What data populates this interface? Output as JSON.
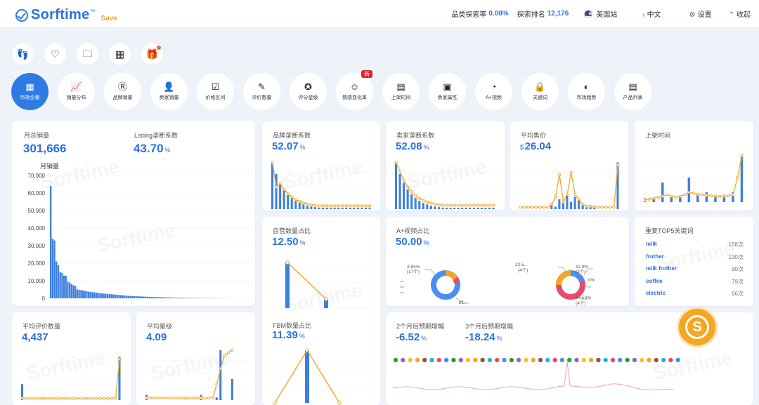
{
  "header": {
    "brand": "Sorftime",
    "trademark": "™",
    "save_label": "Save",
    "cat_label": "品类探索率",
    "cat_value": "0.00%",
    "rank_label": "探索排名",
    "rank_value": "12,176",
    "site_label": "美国站",
    "lang_label": "中文",
    "settings_label": "设置",
    "collapse_label": "收起"
  },
  "quick_icons": [
    "footprint-icon",
    "heart-icon",
    "folder-icon",
    "grid-icon",
    "gift-icon"
  ],
  "tabs": [
    {
      "label": "市场全景",
      "icon": "▦",
      "active": true
    },
    {
      "label": "销量分布",
      "icon": "📈"
    },
    {
      "label": "品牌销量",
      "icon": "Ⓡ"
    },
    {
      "label": "卖家销量",
      "icon": "👤"
    },
    {
      "label": "价格区间",
      "icon": "☑"
    },
    {
      "label": "评价数量",
      "icon": "✎"
    },
    {
      "label": "评分星级",
      "icon": "✪"
    },
    {
      "label": "情感变化率",
      "icon": "☺",
      "badge": "新"
    },
    {
      "label": "上架时间",
      "icon": "▤"
    },
    {
      "label": "卖家属性",
      "icon": "▣"
    },
    {
      "label": "A+视频",
      "icon": "◔"
    },
    {
      "label": "关键词",
      "icon": "🔒"
    },
    {
      "label": "市场趋势",
      "icon": "◐"
    },
    {
      "label": "产品列表",
      "icon": "▤"
    }
  ],
  "watermark": "Sorftime",
  "cards": {
    "monthly_sales": {
      "title": "月总销量",
      "value": "301,666",
      "chart_title": "月销量"
    },
    "listing_monopoly": {
      "title": "Listing垄断系数",
      "value": "43.70",
      "unit": "%"
    },
    "brand_monopoly": {
      "title": "品牌垄断系数",
      "value": "52.07",
      "unit": "%"
    },
    "seller_monopoly": {
      "title": "卖家垄断系数",
      "value": "52.08",
      "unit": "%"
    },
    "avg_price": {
      "title": "平均售价",
      "currency": "$",
      "value": "26.04"
    },
    "listing_time": {
      "title": "上架时间"
    },
    "self_operated": {
      "title": "自营数量占比",
      "value": "12.50",
      "unit": "%"
    },
    "aplus_video": {
      "title": "A+视频占比",
      "value": "50.00",
      "unit": "%"
    },
    "top5_keywords": {
      "title": "重复TOP5关键词",
      "items": [
        {
          "keyword": "milk",
          "count": "158次"
        },
        {
          "keyword": "frother",
          "count": "130次"
        },
        {
          "keyword": "milk frother",
          "count": "90次"
        },
        {
          "keyword": "coffee",
          "count": "79次"
        },
        {
          "keyword": "electric",
          "count": "66次"
        }
      ]
    },
    "avg_reviews": {
      "title": "平均评价数量",
      "value": "4,437"
    },
    "avg_rating": {
      "title": "平均星级",
      "value": "4.09"
    },
    "fbm": {
      "title": "FBM数量占比",
      "value": "11.39",
      "unit": "%"
    },
    "growth2": {
      "title": "2个月后预期增幅",
      "value": "-6.52",
      "unit": "%"
    },
    "growth3": {
      "title": "3个月后预期增幅",
      "value": "-18.24",
      "unit": "%"
    }
  },
  "donut_labels": {
    "left_top": "2.84%",
    "left_top_sub": "(17个)",
    "left_bottom": "81....",
    "right_top_left": "22.5...",
    "right_top_left_sub": "(4个)",
    "right_top": "11.9%",
    "right_top_sub": "(3个)",
    "right_mid": "0%",
    "right_bottom": "64.53%",
    "right_bottom_sub": "(4个)"
  },
  "colors": {
    "accent": "#2d6fdc",
    "bar": "#3d7fe0",
    "line": "#f5a623",
    "badge": "#e21d2f"
  },
  "chart_data": [
    {
      "type": "bar",
      "title": "月销量",
      "yticks": [
        "70,000",
        "60,000",
        "50,000",
        "40,000",
        "30,000",
        "20,000",
        "10,000",
        "0"
      ],
      "ylim": [
        0,
        70000
      ],
      "values": [
        64000,
        34000,
        33000,
        21000,
        19000,
        15000,
        14500,
        13000,
        12800,
        9500,
        9000,
        8000,
        7500,
        7000,
        5000,
        4800,
        4700,
        4500,
        4200,
        4000,
        3800,
        3600,
        3500,
        3400,
        3300,
        3100,
        3000,
        2800,
        2700,
        2600,
        2500,
        2400,
        2300,
        2200,
        2100,
        2000,
        1900,
        1800,
        1700,
        1600,
        1500,
        1400,
        1350,
        1300,
        1250,
        1200,
        1150,
        1100,
        1050,
        1000,
        950,
        900,
        850,
        800,
        760,
        720,
        690,
        660,
        630,
        600,
        570,
        540,
        510,
        480,
        450,
        420,
        400,
        380,
        360,
        340,
        320,
        300,
        280,
        260,
        240,
        220,
        200,
        190,
        180,
        170,
        160,
        150,
        140,
        130,
        120,
        110,
        100,
        90,
        80,
        70,
        60,
        50,
        40,
        30,
        20
      ]
    }
  ]
}
